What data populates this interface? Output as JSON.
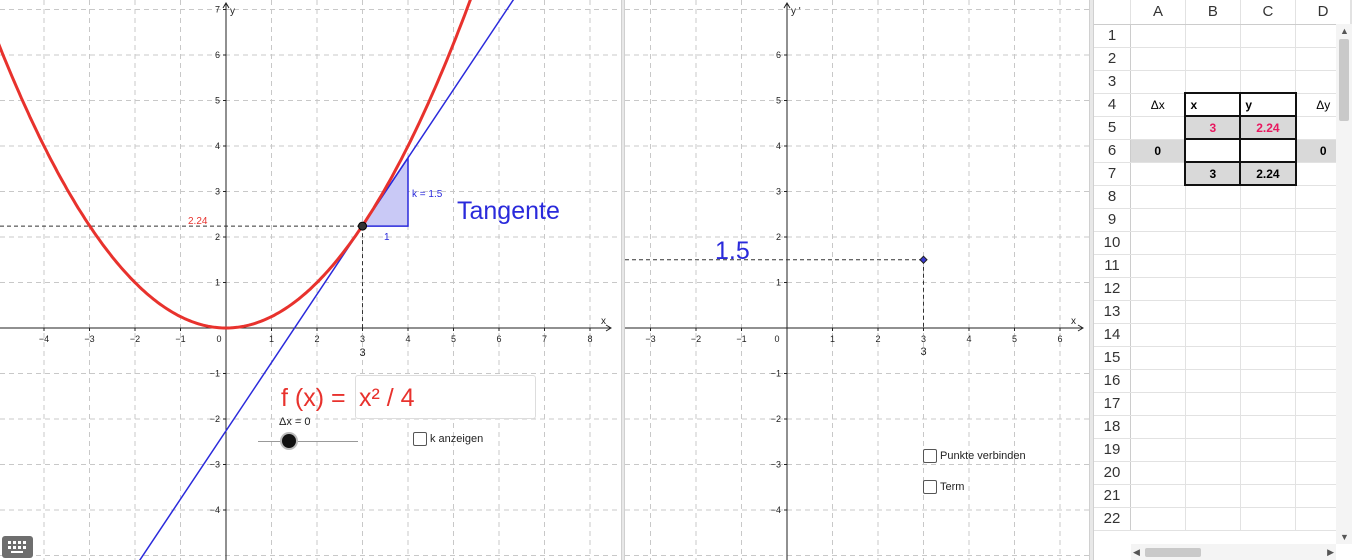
{
  "left_graph": {
    "axis_x_label": "x",
    "axis_y_label": "y",
    "x_ticks": [
      "−4",
      "−3",
      "−2",
      "−1",
      "0",
      "1",
      "2",
      "3",
      "4",
      "5",
      "6",
      "7",
      "8"
    ],
    "y_ticks": [
      "7",
      "6",
      "5",
      "4",
      "3",
      "2",
      "1",
      "−1",
      "−2",
      "−3",
      "−4"
    ],
    "point_x_label": "3",
    "point_y_label": "2.24",
    "slope_label": "k = 1.5",
    "run_label": "1",
    "tangent_label": "Tangente",
    "function_prefix": "f (x) =",
    "function_value": "x² / 4",
    "slider_label": "Δx = 0",
    "slider_value": 0,
    "checkbox_k": "k anzeigen",
    "curve_color": "#e8322d",
    "tangent_color": "#2a2adb"
  },
  "right_graph": {
    "axis_x_label": "x",
    "axis_y_label": "y '",
    "x_ticks": [
      "−3",
      "−2",
      "−1",
      "0",
      "1",
      "2",
      "3",
      "4",
      "5",
      "6"
    ],
    "y_ticks": [
      "6",
      "5",
      "4",
      "3",
      "2",
      "1",
      "−1",
      "−2",
      "−3",
      "−4"
    ],
    "point_x_label": "3",
    "value_label": "1.5",
    "checkbox_connect": "Punkte verbinden",
    "checkbox_term": "Term"
  },
  "spreadsheet": {
    "columns": [
      "A",
      "B",
      "C",
      "D"
    ],
    "rows": [
      "1",
      "2",
      "3",
      "4",
      "5",
      "6",
      "7",
      "8",
      "9",
      "10",
      "11",
      "12",
      "13",
      "14",
      "15",
      "16",
      "17",
      "18",
      "19",
      "20",
      "21",
      "22"
    ],
    "cells": {
      "A4": "Δx",
      "B4": "x",
      "C4": "y",
      "D4": "Δy",
      "B5": "3",
      "C5": "2.24",
      "A6": "0",
      "D6": "0",
      "B7": "3",
      "C7": "2.24"
    }
  }
}
